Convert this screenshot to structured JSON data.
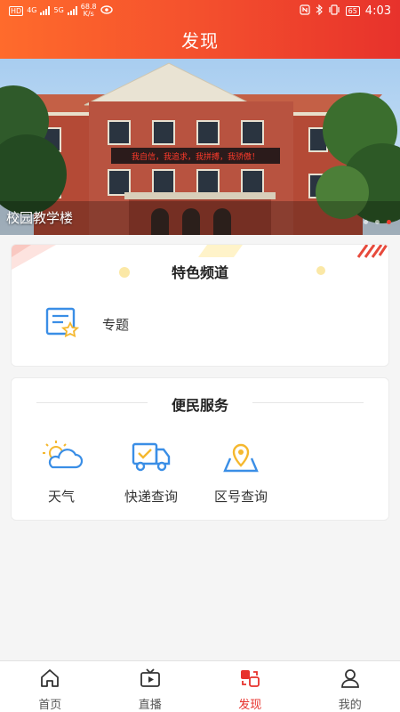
{
  "status_bar": {
    "hd_label": "HD",
    "net_type_1": "4G",
    "net_type_2": "5G",
    "speed": "68.8",
    "speed_unit": "K/s",
    "battery": "65",
    "time": "4:03"
  },
  "header": {
    "title": "发现"
  },
  "banner": {
    "caption": "校园教学楼",
    "sign_text": "我自信，我追求，我拼搏，我骄傲！",
    "slide_count": 3,
    "active_slide": 3
  },
  "featured": {
    "title": "特色频道",
    "items": [
      {
        "label": "专题",
        "icon": "topic-icon"
      }
    ]
  },
  "services": {
    "title": "便民服务",
    "items": [
      {
        "label": "天气",
        "icon": "weather-icon"
      },
      {
        "label": "快递查询",
        "icon": "delivery-truck-icon"
      },
      {
        "label": "区号查询",
        "icon": "location-pin-icon"
      }
    ]
  },
  "tabbar": {
    "active": "发现",
    "items": [
      {
        "label": "首页",
        "icon": "home-icon"
      },
      {
        "label": "直播",
        "icon": "tv-icon"
      },
      {
        "label": "发现",
        "icon": "discover-icon"
      },
      {
        "label": "我的",
        "icon": "profile-icon"
      }
    ]
  },
  "colors": {
    "accent": "#e7322c",
    "icon_blue": "#3a8ee6",
    "icon_yellow": "#f5c02f"
  }
}
